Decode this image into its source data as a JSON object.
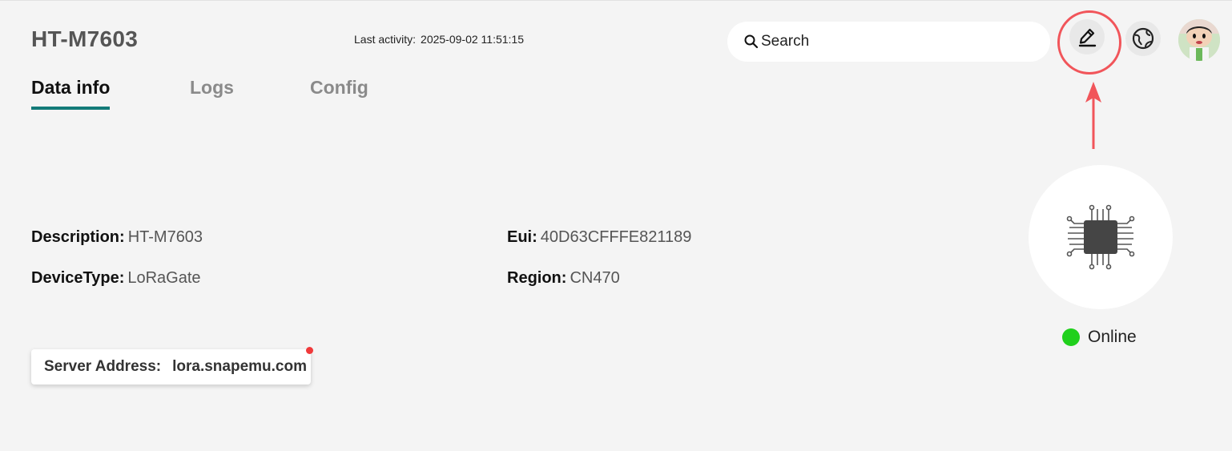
{
  "header": {
    "device_title": "HT-M7603",
    "last_activity_label": "Last activity:",
    "last_activity_value": "2025-09-02 11:51:15"
  },
  "search": {
    "placeholder": "Search"
  },
  "toolbar": {
    "edit_icon": "pencil-icon",
    "globe_icon": "globe-icon"
  },
  "tabs": [
    {
      "label": "Data info",
      "active": true
    },
    {
      "label": "Logs",
      "active": false
    },
    {
      "label": "Config",
      "active": false
    }
  ],
  "info": {
    "description_label": "Description:",
    "description_value": "HT-M7603",
    "devicetype_label": "DeviceType:",
    "devicetype_value": "LoRaGate",
    "eui_label": "Eui:",
    "eui_value": "40D63CFFFE821189",
    "region_label": "Region:",
    "region_value": "CN470"
  },
  "server": {
    "label": "Server Address:",
    "value": "lora.snapemu.com"
  },
  "status": {
    "text": "Online",
    "color": "#20d01c"
  },
  "colors": {
    "accent": "#127a78",
    "highlight": "#f1555a"
  }
}
